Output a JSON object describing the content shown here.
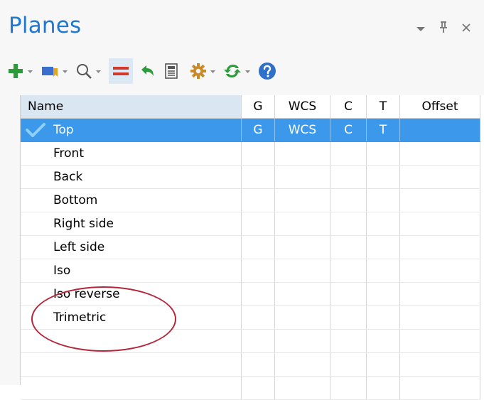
{
  "panel": {
    "title": "Planes"
  },
  "window_controls": [
    "dropdown-icon",
    "pin-icon",
    "close-icon"
  ],
  "toolbar": [
    {
      "name": "add-plane-button",
      "icon": "plus-icon",
      "color": "#2e9b3b",
      "has_dropdown": true
    },
    {
      "name": "flag-button",
      "icon": "flag-icon",
      "color": "#3a6fd0",
      "has_dropdown": true
    },
    {
      "name": "find-button",
      "icon": "search-icon",
      "has_dropdown": true
    },
    {
      "name": "equal-button",
      "icon": "equals-icon",
      "color": "#d03a2c",
      "active": true
    },
    {
      "name": "undo-button",
      "icon": "arrow-back-icon",
      "color": "#2e9b3b"
    },
    {
      "name": "calculator-button",
      "icon": "calculator-icon"
    },
    {
      "name": "settings-button",
      "icon": "gear-icon",
      "color": "#c98a2a",
      "has_dropdown": true
    },
    {
      "name": "refresh-button",
      "icon": "refresh-icon",
      "color": "#2e9b3b",
      "has_dropdown": true
    },
    {
      "name": "help-button",
      "icon": "help-icon",
      "color": "#2f70c8"
    }
  ],
  "grid": {
    "columns": [
      "Name",
      "G",
      "WCS",
      "C",
      "T",
      "Offset"
    ],
    "rows": [
      {
        "name": "Top",
        "g": "G",
        "wcs": "WCS",
        "c": "C",
        "t": "T",
        "offset": "",
        "selected": true,
        "checked": true
      },
      {
        "name": "Front",
        "g": "",
        "wcs": "",
        "c": "",
        "t": "",
        "offset": ""
      },
      {
        "name": "Back",
        "g": "",
        "wcs": "",
        "c": "",
        "t": "",
        "offset": ""
      },
      {
        "name": "Bottom",
        "g": "",
        "wcs": "",
        "c": "",
        "t": "",
        "offset": ""
      },
      {
        "name": "Right side",
        "g": "",
        "wcs": "",
        "c": "",
        "t": "",
        "offset": ""
      },
      {
        "name": "Left side",
        "g": "",
        "wcs": "",
        "c": "",
        "t": "",
        "offset": ""
      },
      {
        "name": "Iso",
        "g": "",
        "wcs": "",
        "c": "",
        "t": "",
        "offset": ""
      },
      {
        "name": "Iso reverse",
        "g": "",
        "wcs": "",
        "c": "",
        "t": "",
        "offset": ""
      },
      {
        "name": "Trimetric",
        "g": "",
        "wcs": "",
        "c": "",
        "t": "",
        "offset": ""
      },
      {
        "name": "",
        "g": "",
        "wcs": "",
        "c": "",
        "t": "",
        "offset": ""
      },
      {
        "name": "",
        "g": "",
        "wcs": "",
        "c": "",
        "t": "",
        "offset": ""
      },
      {
        "name": "",
        "g": "",
        "wcs": "",
        "c": "",
        "t": "",
        "offset": ""
      }
    ]
  },
  "colors": {
    "title": "#1f77d0",
    "selection": "#3c98ea",
    "header_name_bg": "#dbe6f3",
    "annotation_circle": "#b3263a"
  }
}
